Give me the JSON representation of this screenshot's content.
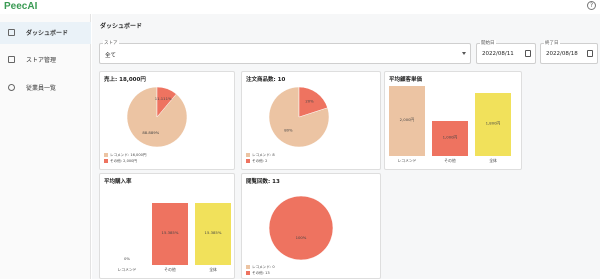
{
  "app": {
    "brand": "PeecAI",
    "help_icon": "help-circle-icon"
  },
  "sidebar": {
    "items": [
      {
        "label": "ダッシュボード",
        "icon": "dashboard-icon",
        "active": true
      },
      {
        "label": "ストア管理",
        "icon": "store-icon",
        "active": false
      },
      {
        "label": "従業員一覧",
        "icon": "people-icon",
        "active": false
      }
    ]
  },
  "page": {
    "title": "ダッシュボード"
  },
  "filters": {
    "store": {
      "label": "ストア",
      "value": "全て"
    },
    "start": {
      "label": "開始日",
      "value": "2022/08/11"
    },
    "end": {
      "label": "終了日",
      "value": "2022/08/18"
    }
  },
  "colors": {
    "recommend": "#ecc4a3",
    "other": "#ee7360",
    "all": "#f1e15b",
    "brand": "#3a9a53"
  },
  "chart_data": [
    {
      "type": "pie",
      "title": "売上: 18,000円",
      "slices": [
        {
          "name": "レコメンド: 16,000円",
          "value": 88.889,
          "label": "88.889%"
        },
        {
          "name": "その他: 2,000円",
          "value": 11.111,
          "label": "11.111%"
        }
      ]
    },
    {
      "type": "pie",
      "title": "注文商品数: 10",
      "slices": [
        {
          "name": "レコメンド: 8",
          "value": 80,
          "label": "80%"
        },
        {
          "name": "その他: 2",
          "value": 20,
          "label": "20%"
        }
      ]
    },
    {
      "type": "bar",
      "title": "平均顧客単価",
      "categories": [
        "レコメンド",
        "その他",
        "全体"
      ],
      "values": [
        2000,
        1000,
        1800
      ],
      "labels": [
        "2,000円",
        "1,000円",
        "1,800円"
      ],
      "ylim": [
        0,
        2000
      ]
    },
    {
      "type": "bar",
      "title": "平均購入率",
      "categories": [
        "レコメンド",
        "その他",
        "全体"
      ],
      "values": [
        0,
        15.385,
        15.385
      ],
      "labels": [
        "0%",
        "15.385%",
        "15.385%"
      ],
      "ylim": [
        0,
        15.385
      ]
    },
    {
      "type": "pie",
      "title": "閲覧回数: 13",
      "slices": [
        {
          "name": "レコメンド: 0",
          "value": 0,
          "label": "0%"
        },
        {
          "name": "その他: 13",
          "value": 100,
          "label": "100%"
        }
      ]
    }
  ]
}
